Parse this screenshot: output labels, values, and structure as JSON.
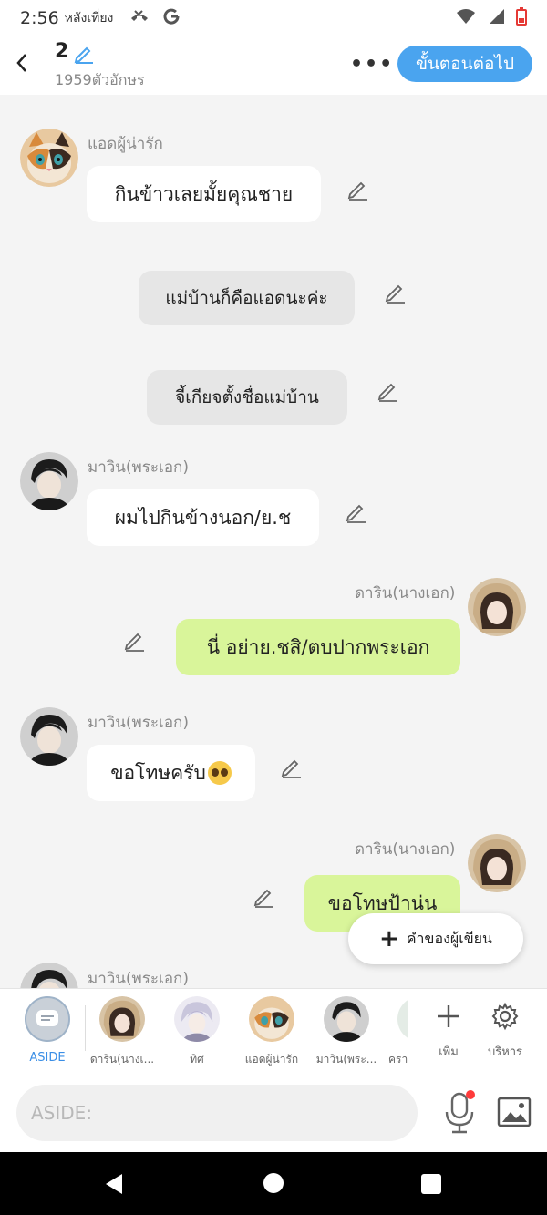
{
  "status_bar": {
    "time": "2:56",
    "period": "หลังเที่ยง",
    "left_icons": [
      "missed-call-icon",
      "google-icon"
    ],
    "right_icons": [
      "wifi-icon",
      "signal-icon",
      "battery-low-icon"
    ]
  },
  "header": {
    "title": "2",
    "char_count": "1959ตัวอักษร",
    "more_label": "•••",
    "next_label": "ขั้นตอนต่อไป"
  },
  "messages": [
    {
      "kind": "incoming",
      "sender": "แอดผู้น่ารัก",
      "text": "กินข้าวเลยมั้ยคุณชาย",
      "avatar": "cat"
    },
    {
      "kind": "narration",
      "text": "แม่บ้านก็คือแอดนะค่ะ"
    },
    {
      "kind": "narration",
      "text": "จี้เกียจตั้งชื่อแม่บ้าน"
    },
    {
      "kind": "incoming",
      "sender": "มาวิน(พระเอก)",
      "text": "ผมไปกินข้างนอก/ย.ช",
      "avatar": "boy"
    },
    {
      "kind": "outgoing",
      "sender": "ดาริน(นางเอก)",
      "text": "นี่ อย่าย.ชสิ/ตบปากพระเอก",
      "avatar": "girl"
    },
    {
      "kind": "incoming",
      "sender": "มาวิน(พระเอก)",
      "text": "ขอโทษครับ",
      "emoji": "pleading-face-emoji",
      "avatar": "boy"
    },
    {
      "kind": "outgoing",
      "sender": "ดาริน(นางเอก)",
      "text": "ขอโทษป้าน่น",
      "avatar": "girl"
    },
    {
      "kind": "incoming",
      "sender": "มาวิน(พระเอก)",
      "text": "",
      "avatar": "boy"
    }
  ],
  "author_button": {
    "label": "คำของผู้เขียน"
  },
  "characters": [
    {
      "label": "ASIDE",
      "kind": "aside"
    },
    {
      "label": "ดาริน(นางเ...",
      "kind": "girl"
    },
    {
      "label": "ทิศ",
      "kind": "silver"
    },
    {
      "label": "แอดผู้น่ารัก",
      "kind": "cat"
    },
    {
      "label": "มาวิน(พระ...",
      "kind": "boy"
    },
    {
      "label": "ครา",
      "kind": "partial"
    }
  ],
  "tools": {
    "add_label": "เพิ่ม",
    "manage_label": "บริหาร"
  },
  "input": {
    "placeholder": "ASIDE:"
  },
  "colors": {
    "accent": "#4aa4ef",
    "outgoing_bubble": "#d9f59a",
    "background": "#f4f4f4"
  }
}
